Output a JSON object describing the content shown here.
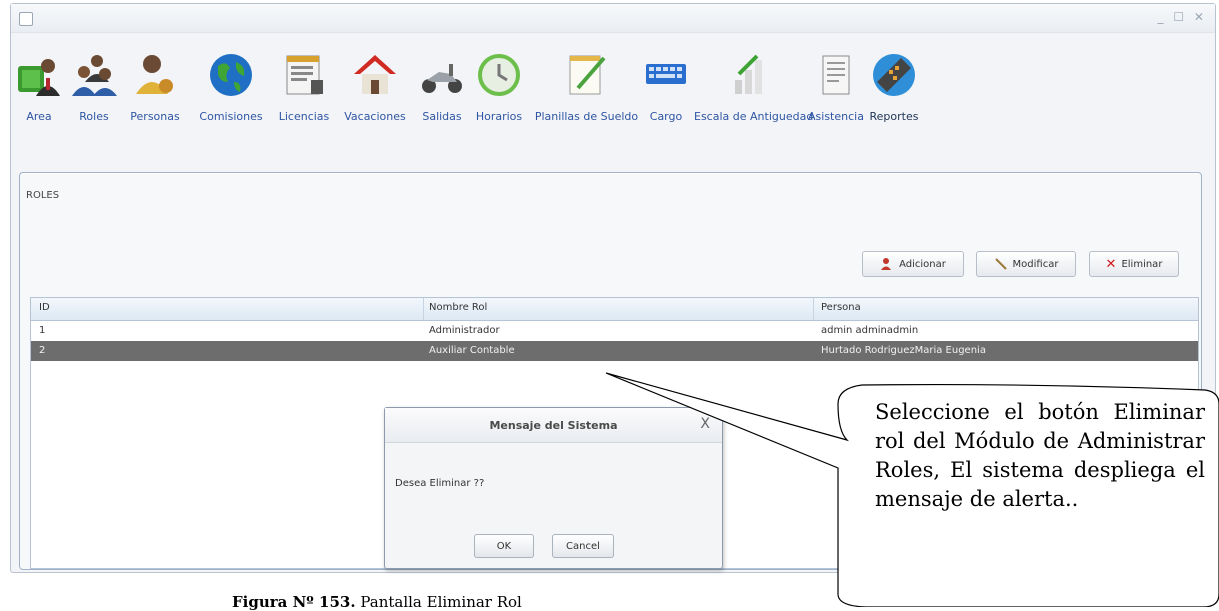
{
  "toolbar": {
    "items": [
      {
        "label": "Area",
        "icon": "area-icon"
      },
      {
        "label": "Roles",
        "icon": "roles-icon"
      },
      {
        "label": "Personas",
        "icon": "personas-icon"
      },
      {
        "label": "Comisiones",
        "icon": "globe-icon"
      },
      {
        "label": "Licencias",
        "icon": "document-icon"
      },
      {
        "label": "Vacaciones",
        "icon": "house-icon"
      },
      {
        "label": "Salidas",
        "icon": "scooter-icon"
      },
      {
        "label": "Horarios",
        "icon": "clock-icon"
      },
      {
        "label": "Planillas de Sueldo",
        "icon": "notepad-icon"
      },
      {
        "label": "Cargo",
        "icon": "keyboard-icon"
      },
      {
        "label": "Escala de Antiguedad",
        "icon": "bar-chart-icon"
      },
      {
        "label": "Asistencia",
        "icon": "clipboard-icon"
      },
      {
        "label": "Reportes",
        "icon": "calculator-icon"
      }
    ]
  },
  "panel": {
    "title": "ROLES",
    "buttons": {
      "add": "Adicionar",
      "edit": "Modificar",
      "delete": "Eliminar"
    }
  },
  "grid": {
    "columns": [
      "ID",
      "Nombre Rol",
      "Persona"
    ],
    "rows": [
      {
        "id": "1",
        "name": "Administrador",
        "person": "admin adminadmin"
      },
      {
        "id": "2",
        "name": "Auxiliar Contable",
        "person": "Hurtado RodriguezMaria Eugenia",
        "selected": true
      }
    ]
  },
  "dialog": {
    "title": "Mensaje del Sistema",
    "message": "Desea Eliminar ??",
    "ok": "OK",
    "cancel": "Cancel",
    "close": "X"
  },
  "callout": {
    "text": "Seleccione el botón Eliminar rol del Módulo de Administrar Roles, El sistema despliega el mensaje de alerta.."
  },
  "caption": {
    "label": "Figura Nº 153.",
    "text": " Pantalla Eliminar Rol"
  },
  "colors": {
    "accent": "#2f55a4",
    "selected_row": "#6d6d6d",
    "delete_red": "#d0191d"
  }
}
